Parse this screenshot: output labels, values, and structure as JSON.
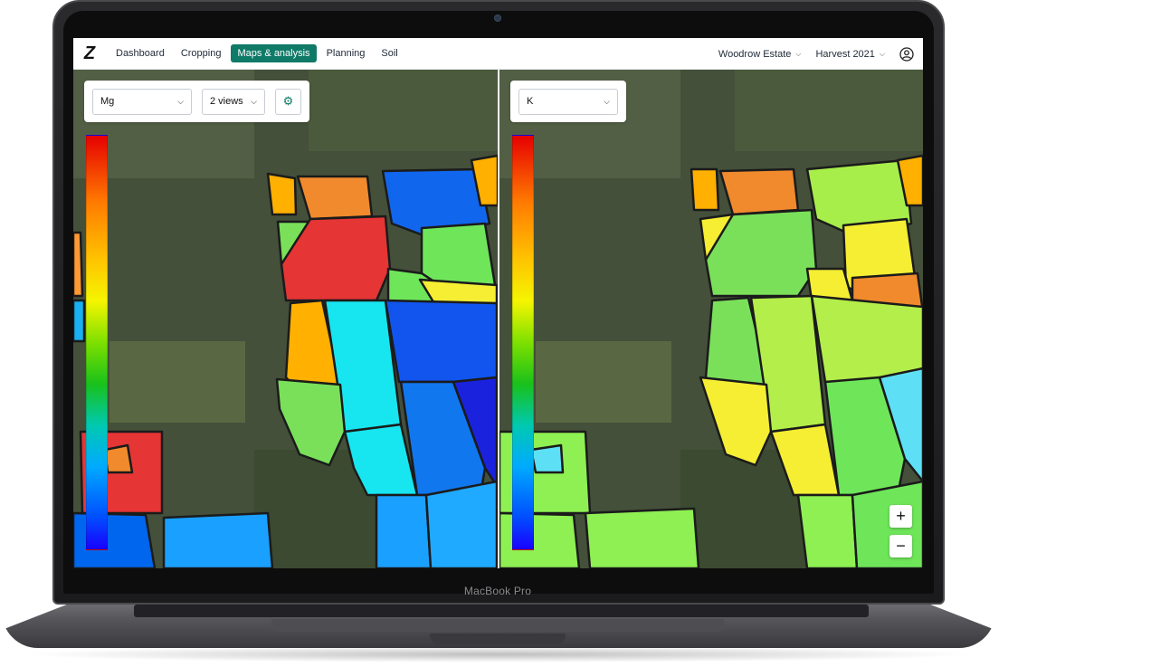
{
  "device": {
    "brand_label": "MacBook Pro"
  },
  "header": {
    "logo_text": "Z",
    "nav": [
      {
        "label": "Dashboard"
      },
      {
        "label": "Cropping"
      },
      {
        "label": "Maps & analysis",
        "active": true
      },
      {
        "label": "Planning"
      },
      {
        "label": "Soil"
      }
    ],
    "estate_label": "Woodrow Estate",
    "harvest_label": "Harvest 2021",
    "user_icon": "user-circle-icon"
  },
  "left_view": {
    "nutrient_select": "Mg",
    "views_select": "2 views",
    "settings_icon": "gear-icon"
  },
  "right_view": {
    "nutrient_select": "K"
  },
  "zoom": {
    "in_label": "+",
    "out_label": "−"
  },
  "colors": {
    "accent": "#0f7a67",
    "scale_high": "#e60000",
    "scale_low": "#1a00ff"
  }
}
